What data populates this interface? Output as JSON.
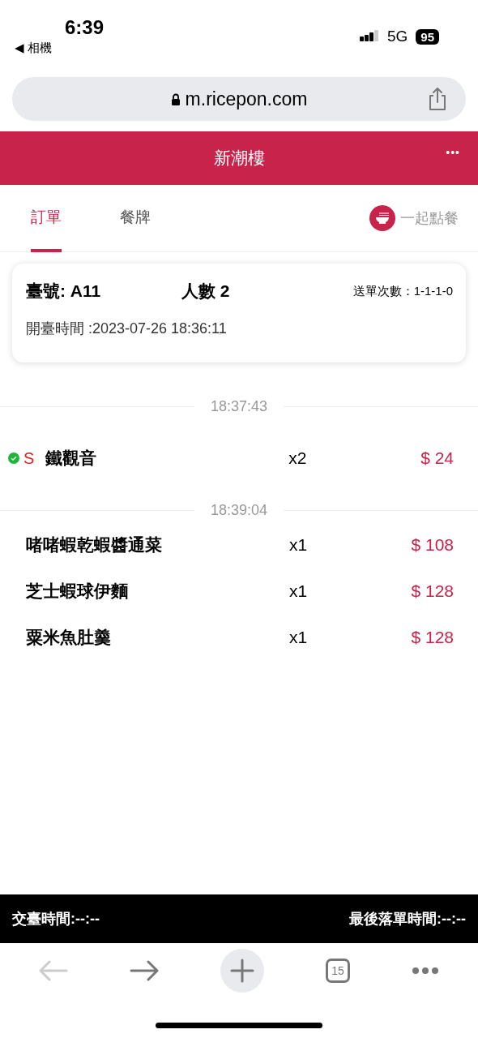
{
  "status_bar": {
    "time": "6:39",
    "back_app": "◀ 相機",
    "network": "5G",
    "battery": "95"
  },
  "browser": {
    "url": "m.ricepon.com"
  },
  "header": {
    "title": "新潮樓",
    "menu": "•••"
  },
  "tabs": [
    {
      "label": "訂單",
      "selected": true
    },
    {
      "label": "餐牌",
      "selected": false
    }
  ],
  "order_together": {
    "label": "一起點餐"
  },
  "table_card": {
    "table": "臺號: A11",
    "guests": "人數 2",
    "submissions": "送單次數：1-1-1-0",
    "opened": "開臺時間 :2023-07-26 18:36:11"
  },
  "order_groups": [
    {
      "time": "18:37:43",
      "items": [
        {
          "name": "鐵觀音",
          "qty": "x2",
          "price": "$ 24",
          "done": true,
          "tag": "S"
        }
      ]
    },
    {
      "time": "18:39:04",
      "items": [
        {
          "name": "啫啫蝦乾蝦醬通菜",
          "qty": "x1",
          "price": "$ 108",
          "done": false
        },
        {
          "name": "芝士蝦球伊麵",
          "qty": "x1",
          "price": "$ 128",
          "done": false
        },
        {
          "name": "粟米魚肚羹",
          "qty": "x1",
          "price": "$ 128",
          "done": false
        }
      ]
    }
  ],
  "footer": {
    "handover_time": "交臺時間:--:--",
    "last_order_time": "最後落單時間:--:--"
  },
  "toolbar": [
    {
      "kind": "back",
      "disabled": true
    },
    {
      "kind": "forward",
      "disabled": false
    },
    {
      "kind": "new",
      "disabled": false
    },
    {
      "kind": "tabs",
      "count": "15",
      "disabled": false
    },
    {
      "kind": "more",
      "disabled": false
    }
  ]
}
